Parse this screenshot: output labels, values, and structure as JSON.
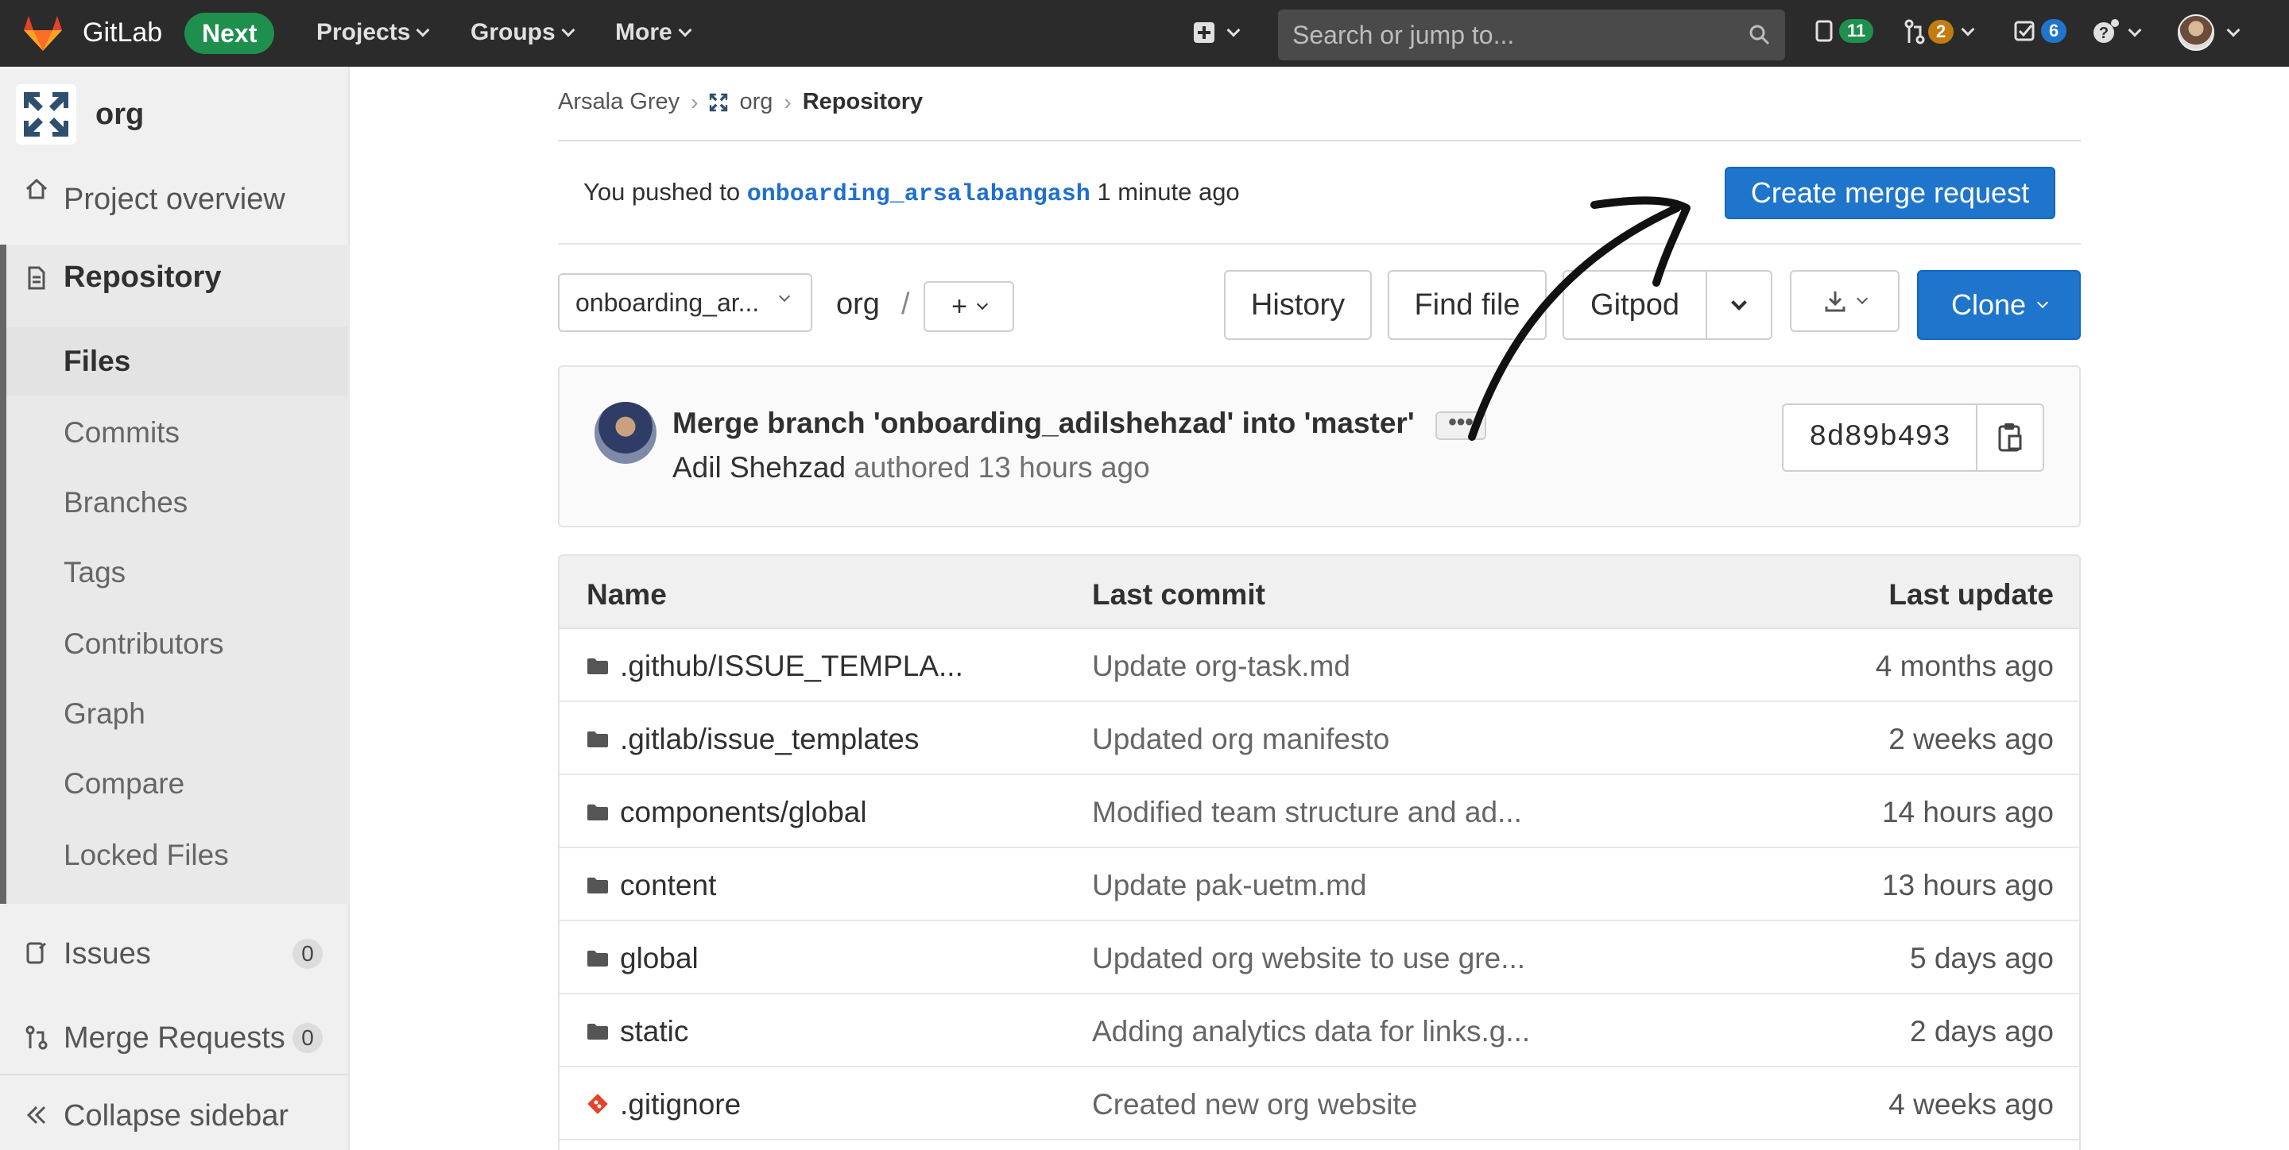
{
  "topnav": {
    "brand": "GitLab",
    "next_badge": "Next",
    "projects": "Projects",
    "groups": "Groups",
    "more": "More",
    "search_placeholder": "Search or jump to...",
    "issues_count": "11",
    "mr_count": "2",
    "todo_count": "6",
    "colors": {
      "bar": "#2b2b2b",
      "issues_badge": "#1f8f4e",
      "mr_badge": "#c17d10",
      "todo_badge": "#1f75cb"
    }
  },
  "sidebar": {
    "project_name": "org",
    "project_overview": "Project overview",
    "repository": "Repository",
    "files": "Files",
    "commits": "Commits",
    "branches": "Branches",
    "tags": "Tags",
    "contributors": "Contributors",
    "graph": "Graph",
    "compare": "Compare",
    "locked_files": "Locked Files",
    "issues": "Issues",
    "issues_count": "0",
    "merge_requests": "Merge Requests",
    "merge_requests_count": "0",
    "collapse": "Collapse sidebar"
  },
  "breadcrumb": {
    "owner": "Arsala Grey",
    "sep": "›",
    "project": "org",
    "current": "Repository"
  },
  "push_alert": {
    "prefix": "You pushed to",
    "branch": "onboarding_arsalabangash",
    "time": "1 minute ago",
    "button": "Create merge request"
  },
  "toolbar": {
    "ref": "onboarding_ar...",
    "path": "org",
    "slash": "/",
    "add": "+",
    "history": "History",
    "find_file": "Find file",
    "gitpod": "Gitpod",
    "clone": "Clone"
  },
  "last_commit": {
    "title": "Merge branch 'onboarding_adilshehzad' into 'master'",
    "ellipsis": "•••",
    "author": "Adil Shehzad",
    "authored": "authored 13 hours ago",
    "sha": "8d89b493"
  },
  "table": {
    "headers": {
      "name": "Name",
      "commit": "Last commit",
      "update": "Last update"
    },
    "rows": [
      {
        "name": ".github/ISSUE_TEMPLA...",
        "commit": "Update org-task.md",
        "update": "4 months ago",
        "type": "folder-icon"
      },
      {
        "name": ".gitlab/issue_templates",
        "commit": "Updated org manifesto",
        "update": "2 weeks ago",
        "type": "folder-icon"
      },
      {
        "name": "components/global",
        "commit": "Modified team structure and ad...",
        "update": "14 hours ago",
        "type": "folder-icon"
      },
      {
        "name": "content",
        "commit": "Update pak-uetm.md",
        "update": "13 hours ago",
        "type": "folder-icon"
      },
      {
        "name": "global",
        "commit": "Updated org website to use gre...",
        "update": "5 days ago",
        "type": "folder-icon"
      },
      {
        "name": "static",
        "commit": "Adding analytics data for links.g...",
        "update": "2 days ago",
        "type": "folder-icon"
      },
      {
        "name": ".gitignore",
        "commit": "Created new org website",
        "update": "4 weeks ago",
        "type": "git-file-icon"
      }
    ]
  }
}
